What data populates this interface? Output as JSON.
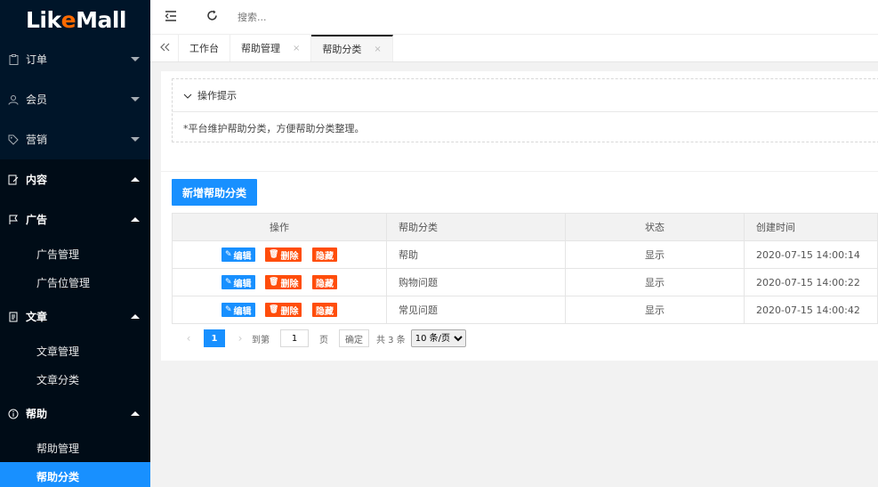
{
  "brand": {
    "logo_pre": "Lik",
    "logo_e": "e",
    "logo_post": "Mall"
  },
  "sidebar": {
    "items": [
      {
        "label": "订单",
        "icon": "clipboard-icon"
      },
      {
        "label": "会员",
        "icon": "user-icon"
      },
      {
        "label": "营销",
        "icon": "tag-icon"
      },
      {
        "label": "内容",
        "icon": "edit-icon"
      },
      {
        "label": "广告",
        "icon": "flag-icon"
      },
      {
        "label": "文章",
        "icon": "document-icon"
      },
      {
        "label": "帮助",
        "icon": "info-icon"
      }
    ],
    "ad_sub": [
      "广告管理",
      "广告位管理"
    ],
    "article_sub": [
      "文章管理",
      "文章分类"
    ],
    "help_sub": [
      "帮助管理",
      "帮助分类"
    ]
  },
  "header": {
    "search_placeholder": "搜索..."
  },
  "tabs": {
    "items": [
      "工作台",
      "帮助管理",
      "帮助分类"
    ],
    "close": "×"
  },
  "tips": {
    "title": "操作提示",
    "body": "*平台维护帮助分类，方便帮助分类整理。"
  },
  "toolbar": {
    "add_label": "新增帮助分类"
  },
  "table": {
    "headers": [
      "操作",
      "帮助分类",
      "状态",
      "创建时间"
    ],
    "actions": {
      "edit": "编辑",
      "delete": "删除",
      "hide": "隐藏"
    },
    "rows": [
      {
        "category": "帮助",
        "status": "显示",
        "created": "2020-07-15 14:00:14"
      },
      {
        "category": "购物问题",
        "status": "显示",
        "created": "2020-07-15 14:00:22"
      },
      {
        "category": "常见问题",
        "status": "显示",
        "created": "2020-07-15 14:00:42"
      }
    ]
  },
  "pager": {
    "current": "1",
    "goto_prefix": "到第",
    "goto_value": "1",
    "goto_suffix": "页",
    "confirm": "确定",
    "total": "共 3 条",
    "page_size": "10 条/页"
  },
  "colors": {
    "sidebar_bg": "#001529",
    "accent": "#1890ff",
    "danger": "#ff4d0b",
    "logo_e": "#ff6a00"
  }
}
